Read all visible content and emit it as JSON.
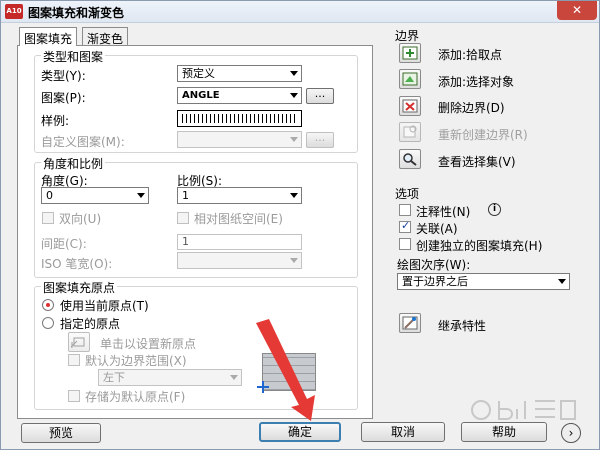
{
  "window": {
    "title": "图案填充和渐变色",
    "app_icon": "A10",
    "close_glyph": "✕"
  },
  "tabs": [
    {
      "label": "图案填充",
      "active": true
    },
    {
      "label": "渐变色",
      "active": false
    }
  ],
  "type_pattern": {
    "group_label": "类型和图案",
    "type_label": "类型(Y):",
    "type_value": "预定义",
    "pattern_label": "图案(P):",
    "pattern_value": "ANGLE",
    "ellipsis": "...",
    "swatch_label": "样例:",
    "custom_label": "自定义图案(M):",
    "custom_value": ""
  },
  "angle_scale": {
    "group_label": "角度和比例",
    "angle_label": "角度(G):",
    "angle_value": "0",
    "scale_label": "比例(S):",
    "scale_value": "1",
    "double_label": "双向(U)",
    "relative_label": "相对图纸空间(E)",
    "spacing_label": "间距(C):",
    "spacing_value": "1",
    "iso_label": "ISO 笔宽(O):",
    "iso_value": ""
  },
  "origin": {
    "group_label": "图案填充原点",
    "use_current_label": "使用当前原点(T)",
    "specified_label": "指定的原点",
    "click_set_label": "单击以设置新原点",
    "default_extent_label": "默认为边界范围(X)",
    "extent_value": "左下",
    "store_default_label": "存储为默认原点(F)"
  },
  "boundary": {
    "header": "边界",
    "add_pick": "添加:拾取点",
    "add_select": "添加:选择对象",
    "remove": "删除边界(D)",
    "recreate": "重新创建边界(R)",
    "view_selection": "查看选择集(V)"
  },
  "options": {
    "header": "选项",
    "annotative": "注释性(N)",
    "associative": "关联(A)",
    "separate": "创建独立的图案填充(H)",
    "draw_order_label": "绘图次序(W):",
    "draw_order_value": "置于边界之后",
    "info_glyph": "i"
  },
  "inherit": {
    "label": "继承特性"
  },
  "footer": {
    "preview": "预览",
    "ok": "确定",
    "cancel": "取消",
    "help": "帮助",
    "more_glyph": "›"
  },
  "colors": {
    "accent": "#3c7fb1",
    "red_arrow": "#e53935",
    "title_icon": "#c62828"
  }
}
